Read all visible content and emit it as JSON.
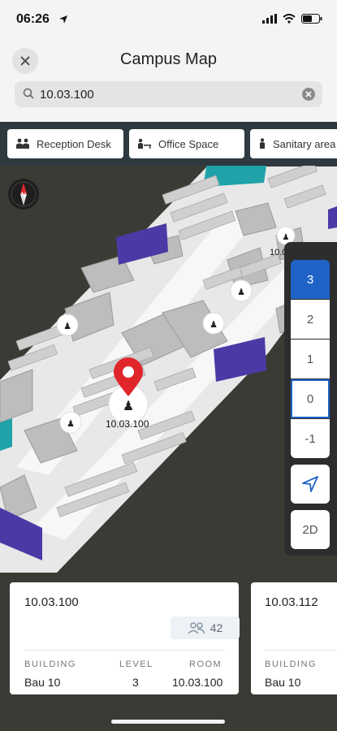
{
  "status": {
    "time": "06:26"
  },
  "header": {
    "title": "Campus Map"
  },
  "search": {
    "value": "10.03.100"
  },
  "filters": [
    {
      "label": "Reception Desk",
      "icon": "people-icon"
    },
    {
      "label": "Office Space",
      "icon": "desk-person-icon"
    },
    {
      "label": "Sanitary area",
      "icon": "person-icon"
    }
  ],
  "map": {
    "pin_label": "10.03.100",
    "partial_label": "10.0",
    "accent_colors": {
      "pin": "#e0262b",
      "stairs": "#4b3aa6",
      "glass": "#1fa3a8"
    }
  },
  "floors": {
    "levels": [
      "3",
      "2",
      "1",
      "0",
      "-1"
    ],
    "active": "3",
    "current": "0",
    "mode_label": "2D"
  },
  "cards": [
    {
      "title": "10.03.100",
      "capacity": "42",
      "building_label": "BUILDING",
      "building": "Bau 10",
      "level_label": "LEVEL",
      "level": "3",
      "room_label": "ROOM",
      "room": "10.03.100"
    },
    {
      "title": "10.03.112",
      "building_label": "BUILDING",
      "building": "Bau 10"
    }
  ]
}
